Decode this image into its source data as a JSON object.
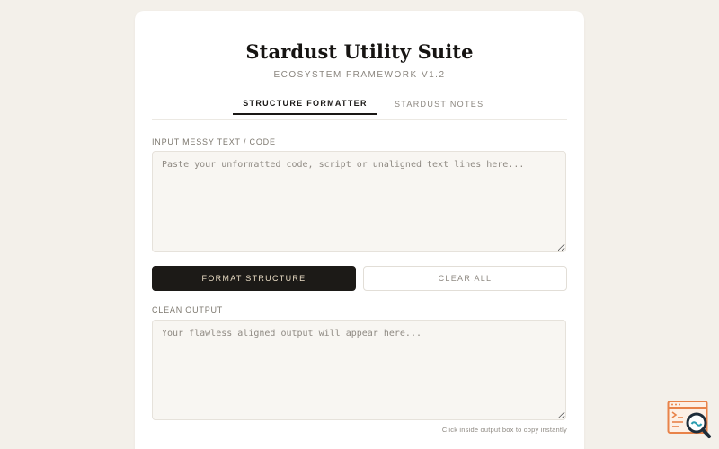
{
  "app": {
    "title": "Stardust Utility Suite",
    "subtitle": "ECOSYSTEM FRAMEWORK V1.2"
  },
  "tabs": [
    {
      "label": "STRUCTURE FORMATTER",
      "active": true
    },
    {
      "label": "STARDUST NOTES",
      "active": false
    }
  ],
  "input": {
    "label": "INPUT MESSY TEXT / CODE",
    "placeholder": "Paste your unformatted code, script or unaligned text lines here...",
    "value": ""
  },
  "actions": {
    "format_label": "FORMAT STRUCTURE",
    "clear_label": "CLEAR ALL"
  },
  "output": {
    "label": "CLEAN OUTPUT",
    "placeholder": "Your flawless aligned output will appear here...",
    "value": "",
    "hint": "Click inside output box to copy instantly"
  },
  "widget": {
    "icon": "code-search-icon",
    "accent_color": "#e8834a"
  },
  "colors": {
    "page_background": "#f3f0ea",
    "card_background": "#ffffff",
    "primary_button": "#1c1a17",
    "primary_button_text": "#e9dcc4",
    "field_background": "#f8f6f2"
  }
}
